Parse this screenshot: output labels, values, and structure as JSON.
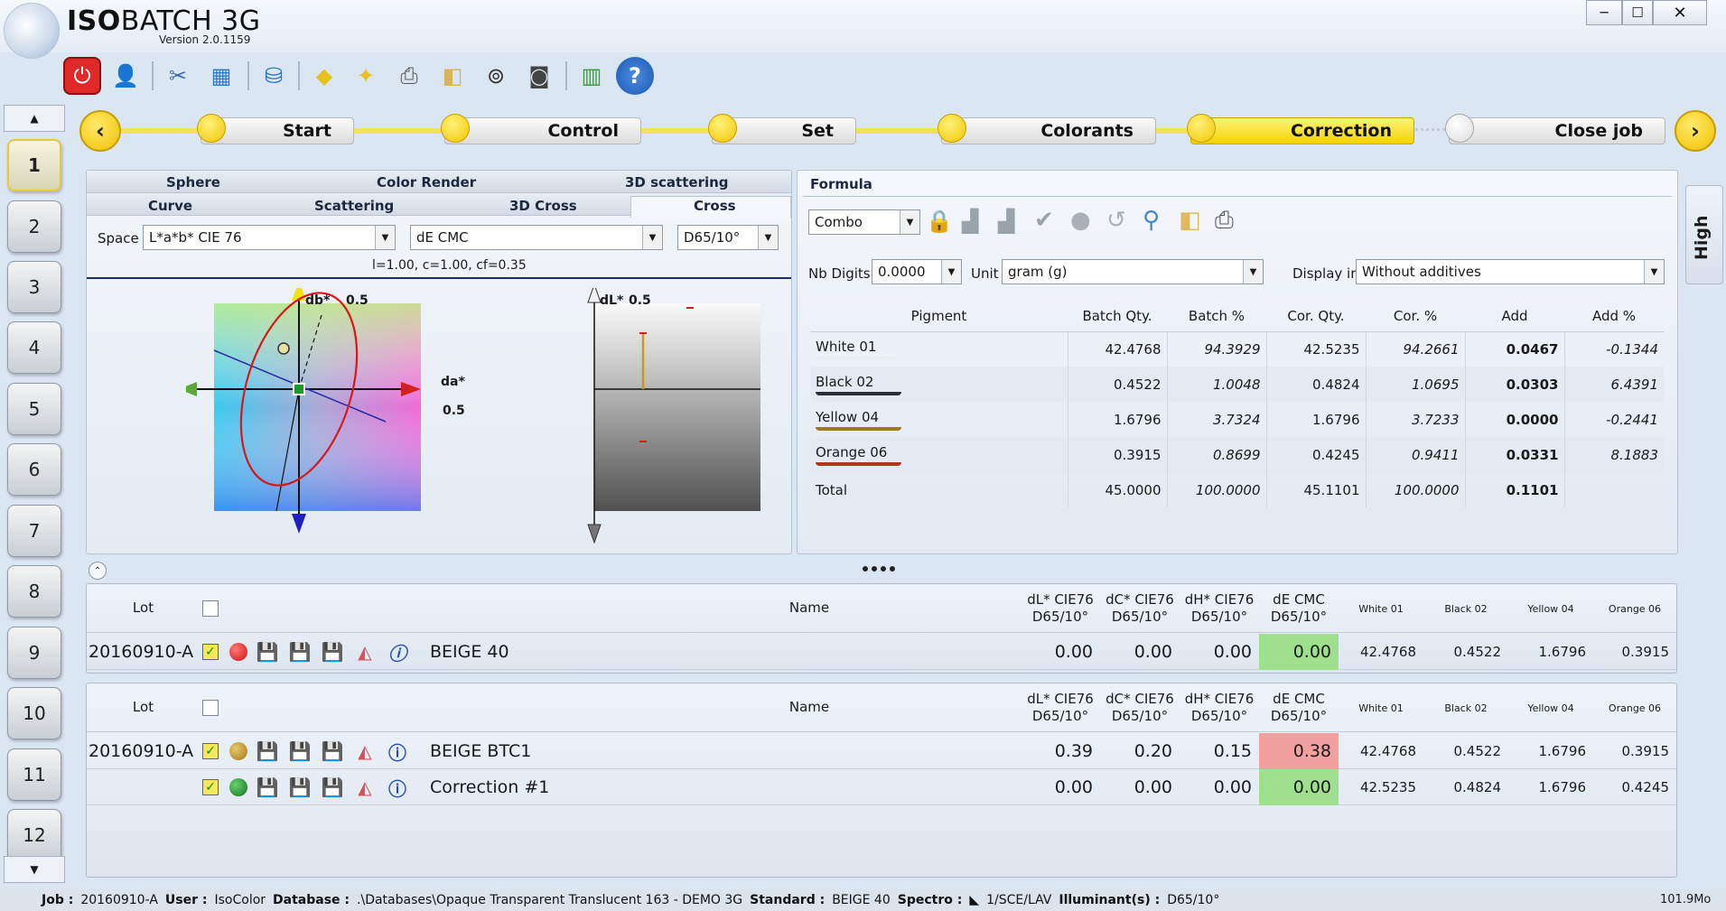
{
  "app": {
    "title_bold": "ISO",
    "title_rest": "BATCH 3G",
    "version": "Version 2.0.1159"
  },
  "window_controls": {
    "minimize": "─",
    "maximize": "☐",
    "close": "✕"
  },
  "toolbar": {
    "icons": [
      "power-icon",
      "user-icon",
      "tools-icon",
      "grid-icon",
      "database-icon",
      "eraser-icon",
      "eraser-wand-icon",
      "printer-icon",
      "paper-icon",
      "binoculars-icon",
      "camera-icon",
      "book-icon",
      "help-icon"
    ]
  },
  "sidebar": {
    "items": [
      "1",
      "2",
      "3",
      "4",
      "5",
      "6",
      "7",
      "8",
      "9",
      "10",
      "11",
      "12"
    ],
    "active": "1",
    "scroll_up": "▲",
    "scroll_down": "▼"
  },
  "wizard": {
    "prev": "‹",
    "next": "›",
    "steps": [
      "Start",
      "Control",
      "Set",
      "Colorants",
      "Correction",
      "Close job"
    ],
    "current": "Correction"
  },
  "left_panel": {
    "tabs_row1": [
      "Sphere",
      "Color Render",
      "3D scattering"
    ],
    "tabs_row2": [
      "Curve",
      "Scattering",
      "3D Cross",
      "Cross"
    ],
    "selected_tab": "Cross",
    "space_label": "Space",
    "space_value": "L*a*b* CIE 76",
    "formula_value": "dE CMC",
    "illuminant_value": "D65/10°",
    "params": "l=1.00, c=1.00, cf=0.35",
    "ab_plot": {
      "y_label": "db*",
      "y_max": "0.5",
      "x_label": "da*",
      "x_max": "0.5"
    },
    "l_plot": {
      "label": "dL*",
      "max": "0.5"
    }
  },
  "right_panel": {
    "title": "Formula",
    "combo_value": "Combo",
    "nb_digits_label": "Nb Digits",
    "nb_digits_value": "0.0000",
    "unit_label": "Unit",
    "unit_value": "gram (g)",
    "display_label": "Display in",
    "display_value": "Without additives",
    "high_tab": "High",
    "columns": [
      "Pigment",
      "Batch Qty.",
      "Batch %",
      "Cor. Qty.",
      "Cor. %",
      "Add",
      "Add %"
    ],
    "rows": [
      {
        "name": "White 01",
        "batch_qty": "42.4768",
        "batch_pct": "94.3929",
        "cor_qty": "42.5235",
        "cor_pct": "94.2661",
        "add": "0.0467",
        "add_pct": "-0.1344",
        "color": "#e9eef2"
      },
      {
        "name": "Black 02",
        "batch_qty": "0.4522",
        "batch_pct": "1.0048",
        "cor_qty": "0.4824",
        "cor_pct": "1.0695",
        "add": "0.0303",
        "add_pct": "6.4391",
        "color": "#2a2f35"
      },
      {
        "name": "Yellow 04",
        "batch_qty": "1.6796",
        "batch_pct": "3.7324",
        "cor_qty": "1.6796",
        "cor_pct": "3.7233",
        "add": "0.0000",
        "add_pct": "-0.2441",
        "color": "#9a7a1a"
      },
      {
        "name": "Orange 06",
        "batch_qty": "0.3915",
        "batch_pct": "0.8699",
        "cor_qty": "0.4245",
        "cor_pct": "0.9411",
        "add": "0.0331",
        "add_pct": "8.1883",
        "color": "#b0361e"
      },
      {
        "name": "Total",
        "batch_qty": "45.0000",
        "batch_pct": "100.0000",
        "cor_qty": "45.1101",
        "cor_pct": "100.0000",
        "add": "0.1101",
        "add_pct": "",
        "color": ""
      }
    ]
  },
  "grid_headers": {
    "lot": "Lot",
    "name": "Name",
    "dL1": "dL* CIE76",
    "dL2": "D65/10°",
    "dC1": "dC* CIE76",
    "dC2": "D65/10°",
    "dH1": "dH* CIE76",
    "dH2": "D65/10°",
    "dE1": "dE CMC",
    "dE2": "D65/10°",
    "pigments": [
      "White 01",
      "Black 02",
      "Yellow 04",
      "Orange 06"
    ]
  },
  "standard_grid": {
    "rows": [
      {
        "lot": "20160910-A",
        "name": "BEIGE 40",
        "dL": "0.00",
        "dC": "0.00",
        "dH": "0.00",
        "dE": "0.00",
        "dE_color": "#9fe08f",
        "ball": "#e01818",
        "p": [
          "42.4768",
          "0.4522",
          "1.6796",
          "0.3915"
        ]
      }
    ]
  },
  "batch_grid": {
    "rows": [
      {
        "lot": "20160910-A",
        "name": "BEIGE BTC1",
        "dL": "0.39",
        "dC": "0.20",
        "dH": "0.15",
        "dE": "0.38",
        "dE_color": "#f2a0a0",
        "ball": "#b8902a",
        "p": [
          "42.4768",
          "0.4522",
          "1.6796",
          "0.3915"
        ]
      },
      {
        "lot": "",
        "name": "Correction #1",
        "dL": "0.00",
        "dC": "0.00",
        "dH": "0.00",
        "dE": "0.00",
        "dE_color": "#9fe08f",
        "ball": "#1c8a2a",
        "p": [
          "42.5235",
          "0.4824",
          "1.6796",
          "0.4245"
        ]
      }
    ]
  },
  "status": {
    "job_label": "Job :",
    "job": "20160910-A",
    "user_label": "User :",
    "user": "IsoColor",
    "db_label": "Database :",
    "db": ".\\Databases\\Opaque Transparent Translucent 163 - DEMO 3G",
    "standard_label": "Standard :",
    "standard": "BEIGE 40",
    "spectro_label": "Spectro :",
    "spectro": "1/SCE/LAV",
    "illum_label": "Illuminant(s) :",
    "illum": "D65/10°",
    "zoom": "101.9Mo"
  }
}
